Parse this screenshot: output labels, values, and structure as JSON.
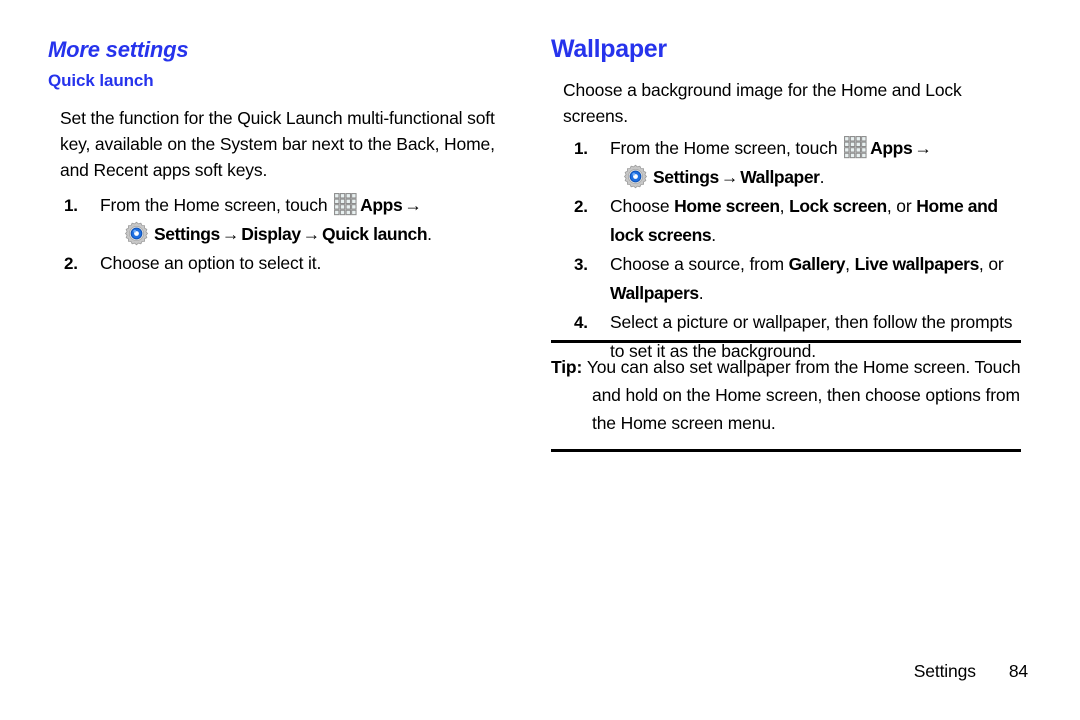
{
  "page": {
    "background": "#ffffff",
    "accent_blue": "#2633ec",
    "text_color": "#000000"
  },
  "left_column": {
    "section_heading": "More settings",
    "sub_heading": "Quick launch",
    "intro": "Set the function for the Quick Launch multi-functional soft key, available on the System bar next to the Back, Home, and Recent apps soft keys.",
    "steps": [
      {
        "number": "1.",
        "line1_before_icon": "From the Home screen, touch ",
        "apps_icon": "apps-grid-icon",
        "apps_label": "Apps",
        "arrow1": "→",
        "gear_icon": "settings-gear-icon",
        "settings_label": "Settings",
        "arrow2": "→",
        "display_label": "Display",
        "arrow3": "→",
        "quick_launch_label": "Quick launch",
        "period": "."
      },
      {
        "number": "2.",
        "text": "Choose an option to select it."
      }
    ]
  },
  "right_column": {
    "chapter_heading": "Wallpaper",
    "intro": "Choose a background image for the Home and Lock screens.",
    "steps": [
      {
        "number": "1.",
        "line1_before_icon": "From the Home screen, touch ",
        "apps_icon": "apps-grid-icon",
        "apps_label": "Apps",
        "arrow1": "→",
        "gear_icon": "settings-gear-icon",
        "settings_label": "Settings",
        "arrow2": "→",
        "wallpaper_label": "Wallpaper",
        "period": "."
      },
      {
        "number": "2.",
        "prefix": "Choose ",
        "opt1": "Home screen",
        "sep1": ", ",
        "opt2": "Lock screen",
        "sep2": ", or ",
        "opt3": "Home and lock screens",
        "period": "."
      },
      {
        "number": "3.",
        "prefix": "Choose a source, from ",
        "opt1": "Gallery",
        "sep1": ", ",
        "opt2": "Live wallpapers",
        "sep2": ", or ",
        "opt3": "Wallpapers",
        "period": "."
      },
      {
        "number": "4.",
        "text": "Select a picture or wallpaper, then follow the prompts to set it as the background."
      }
    ],
    "tip": {
      "label": "Tip:",
      "text": "You can also set wallpaper from the Home screen. Touch and hold on the Home screen, then choose options from the Home screen menu."
    }
  },
  "footer": {
    "label": "Settings",
    "page_number": "84"
  }
}
